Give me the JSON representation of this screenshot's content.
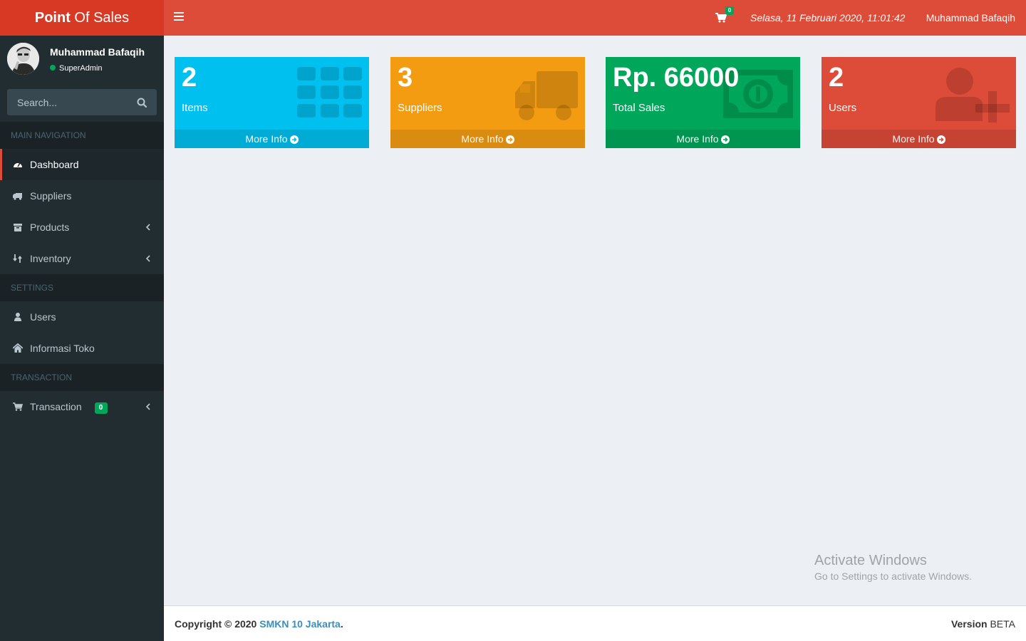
{
  "header": {
    "logo_bold": "Point",
    "logo_rest": "Of Sales",
    "cart_count": "0",
    "datetime": "Selasa, 11 Februari 2020, 11:01:42",
    "user_name": "Muhammad Bafaqih"
  },
  "sidebar": {
    "user_name": "Muhammad Bafaqih",
    "user_role": "SuperAdmin",
    "search_placeholder": "Search...",
    "headers": [
      "MAIN NAVIGATION",
      "SETTINGS",
      "TRANSACTION"
    ],
    "items": [
      {
        "label": "Dashboard",
        "icon": "dashboard-icon",
        "active": true
      },
      {
        "label": "Suppliers",
        "icon": "truck-icon"
      },
      {
        "label": "Products",
        "icon": "archive-icon",
        "submenu": true
      },
      {
        "label": "Inventory",
        "icon": "inventory-icon",
        "submenu": true
      },
      {
        "label": "Users",
        "icon": "user-icon"
      },
      {
        "label": "Informasi Toko",
        "icon": "home-icon"
      },
      {
        "label": "Transaction",
        "icon": "cart-icon",
        "submenu": true,
        "badge": "0"
      }
    ]
  },
  "boxes": [
    {
      "value": "2",
      "label": "Items",
      "footer": "More Info",
      "color": "#00c0ef",
      "icon": "grid-icon"
    },
    {
      "value": "3",
      "label": "Suppliers",
      "footer": "More Info",
      "color": "#f39c12",
      "icon": "truck-icon"
    },
    {
      "value": "Rp. 66000",
      "label": "Total Sales",
      "footer": "More Info",
      "color": "#00a65a",
      "icon": "money-icon"
    },
    {
      "value": "2",
      "label": "Users",
      "footer": "More Info",
      "color": "#dd4b39",
      "icon": "user-plus-icon"
    }
  ],
  "watermark": {
    "line1": "Activate Windows",
    "line2": "Go to Settings to activate Windows."
  },
  "footer": {
    "copyright_prefix": "Copyright © 2020",
    "copyright_link": "SMKN 10 Jakarta",
    "copyright_suffix": ".",
    "version_label": "Version",
    "version_value": "BETA"
  },
  "colors": {
    "brand_red": "#dd4b39",
    "logo_red": "#d73925",
    "sidebar_bg": "#222d32",
    "content_bg": "#ecf0f5"
  }
}
